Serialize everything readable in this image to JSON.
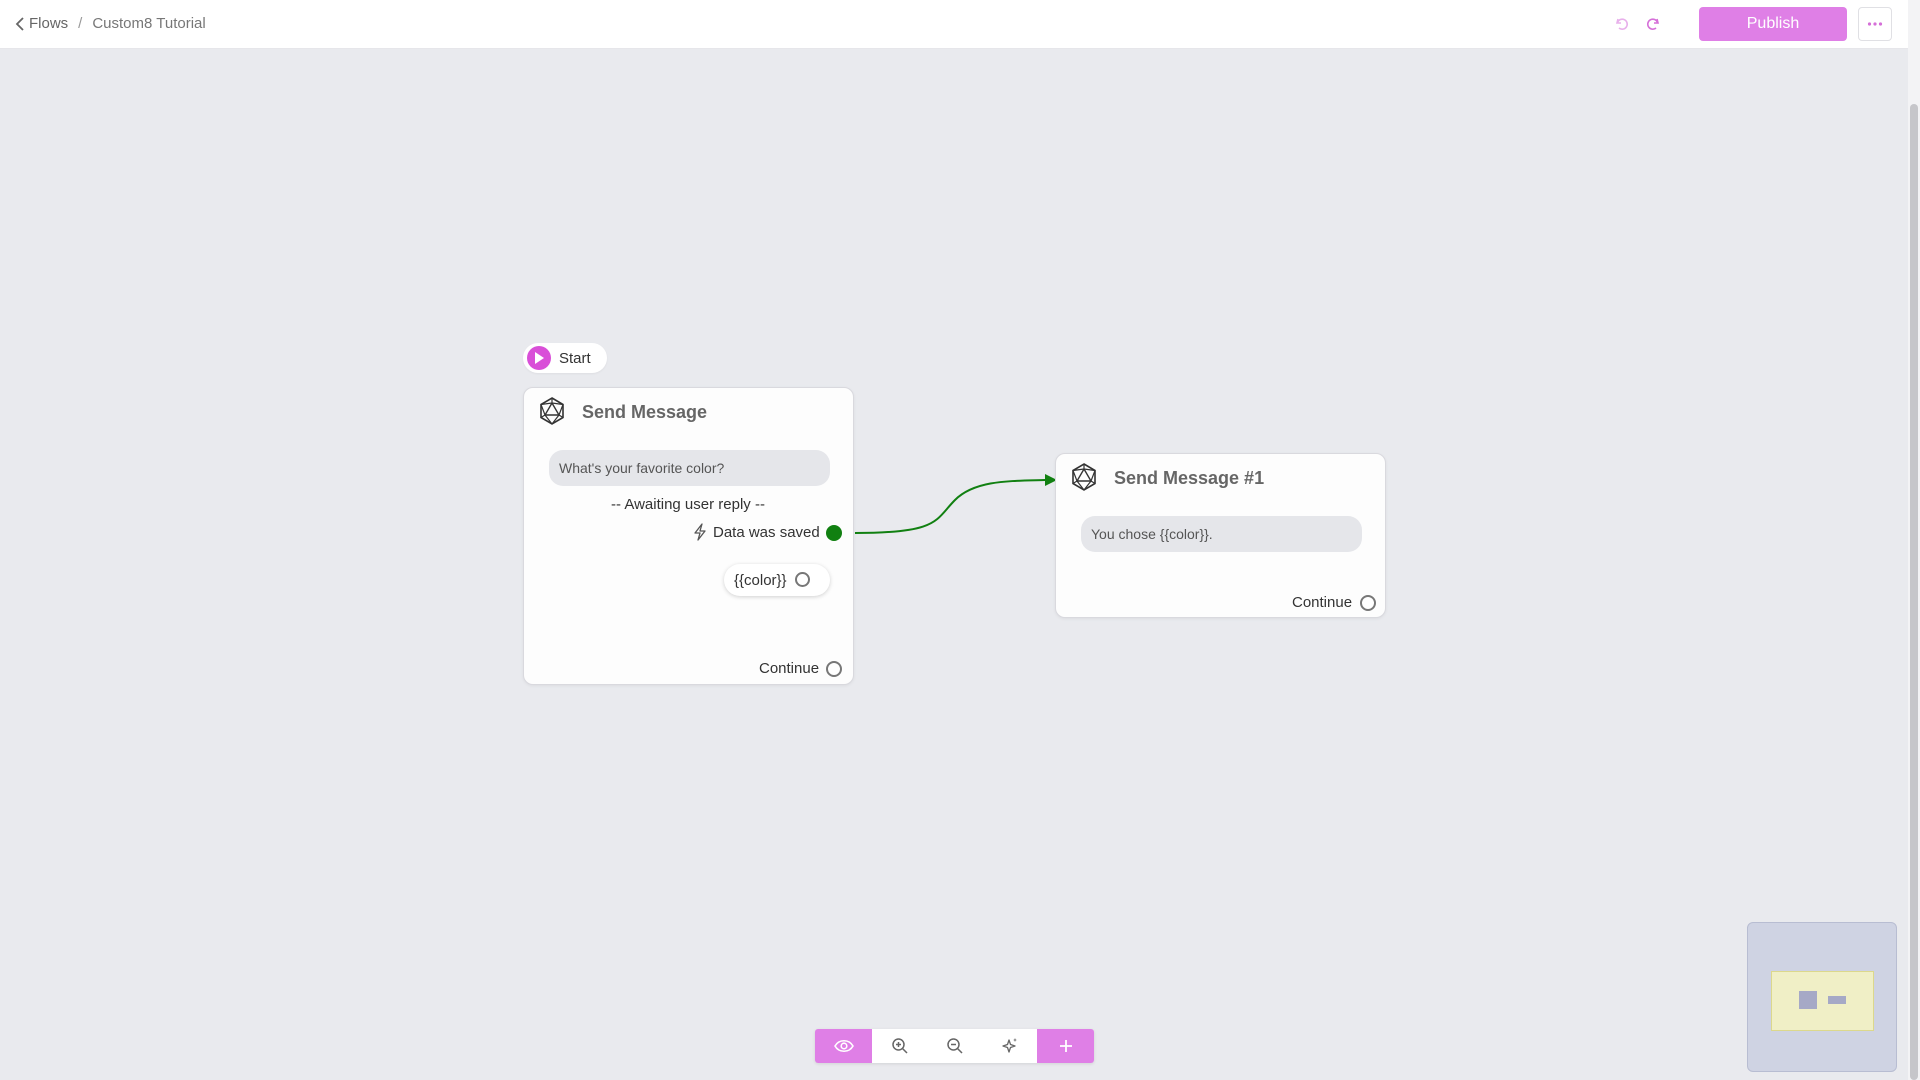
{
  "header": {
    "back_label": "Flows",
    "separator": "/",
    "flow_name": "Custom8 Tutorial",
    "publish_label": "Publish"
  },
  "flow": {
    "start_label": "Start",
    "nodes": [
      {
        "title": "Send Message",
        "message": "What's your favorite color?",
        "awaiting": "-- Awaiting user reply --",
        "data_saved": "Data was saved",
        "variable": "{{color}}",
        "continue": "Continue"
      },
      {
        "title": "Send Message #1",
        "message": "You chose {{color}}.",
        "continue": "Continue"
      }
    ]
  },
  "colors": {
    "accent": "#df7fe6",
    "start_icon": "#d94fd8",
    "edge": "#118011",
    "canvas": "#e9eaee"
  },
  "icons": {
    "back": "chevron-left-icon",
    "undo": "undo-icon",
    "redo": "redo-icon",
    "more": "ellipsis-icon",
    "node": "icosahedron-icon",
    "trigger": "lightning-icon",
    "preview": "eye-icon",
    "zoom_in": "zoom-in-icon",
    "zoom_out": "zoom-out-icon",
    "auto_layout": "sparkle-icon",
    "add": "plus-icon"
  }
}
